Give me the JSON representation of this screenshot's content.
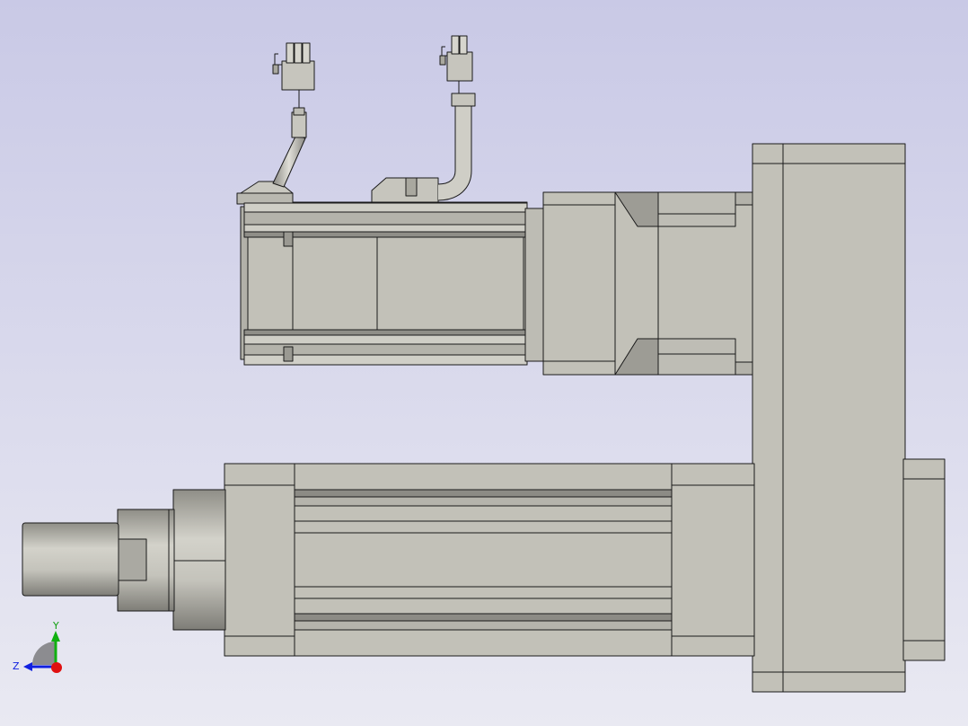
{
  "colors": {
    "background_top": "#c9c9e6",
    "background_bottom": "#e9e9f2",
    "part_fill": "#c2c1b8",
    "part_light": "#d6d5cc",
    "part_dark": "#9f9e96",
    "edge": "#1a1a1a",
    "axis_x": "#e01010",
    "axis_y": "#10b010",
    "axis_z": "#1020e0"
  },
  "triad": {
    "y_label": "Y",
    "z_label": "Z"
  }
}
